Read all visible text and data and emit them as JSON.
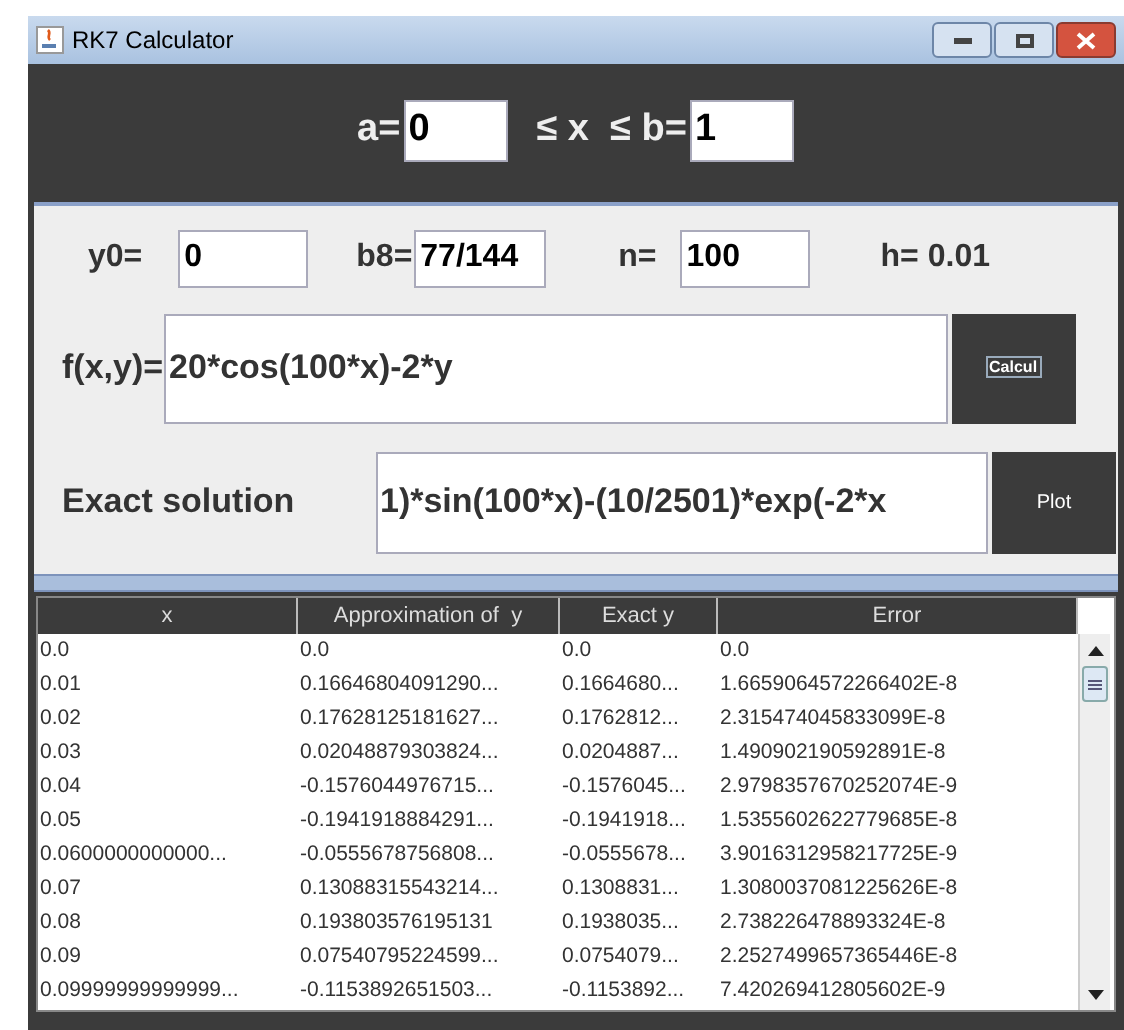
{
  "window": {
    "title": "RK7 Calculator"
  },
  "range": {
    "a_label": "a=",
    "a_value": "0",
    "x_label": "≤ x  ≤ b=",
    "b_value": "1"
  },
  "params": [
    {
      "label": "y0=",
      "value": "0"
    },
    {
      "label": "b8=",
      "value": "77/144"
    },
    {
      "label": "n=",
      "value": "100"
    }
  ],
  "step": "h= 0.01",
  "function": {
    "label": "f(x,y)=",
    "value": "20*cos(100*x)-2*y",
    "button": "Calcul"
  },
  "exact": {
    "label": "Exact solution",
    "value": "1)*sin(100*x)-(10/2501)*exp(-2*x",
    "button": "Plot"
  },
  "table": {
    "columns": [
      "x",
      "Approximation of  y",
      "Exact y",
      "Error"
    ],
    "rows": [
      [
        "0.0",
        "0.0",
        "0.0",
        "0.0"
      ],
      [
        "0.01",
        "0.16646804091290...",
        "0.1664680...",
        "1.6659064572266402E-8"
      ],
      [
        "0.02",
        "0.17628125181627...",
        "0.1762812...",
        "2.315474045833099E-8"
      ],
      [
        "0.03",
        "0.02048879303824...",
        "0.0204887...",
        "1.490902190592891E-8"
      ],
      [
        "0.04",
        "-0.1576044976715...",
        "-0.1576045...",
        "2.9798357670252074E-9"
      ],
      [
        "0.05",
        "-0.1941918884291...",
        "-0.1941918...",
        "1.5355602622779685E-8"
      ],
      [
        "0.0600000000000...",
        "-0.0555678756808...",
        "-0.0555678...",
        "3.9016312958217725E-9"
      ],
      [
        "0.07",
        "0.13088315543214...",
        "0.1308831...",
        "1.3080037081225626E-8"
      ],
      [
        "0.08",
        "0.193803576195131",
        "0.1938035...",
        "2.738226478893324E-8"
      ],
      [
        "0.09",
        "0.07540795224599...",
        "0.0754079...",
        "2.2527499657365446E-8"
      ],
      [
        "0.09999999999999...",
        "-0.1153892651503...",
        "-0.1153892...",
        "7.420269412805602E-9"
      ]
    ]
  }
}
